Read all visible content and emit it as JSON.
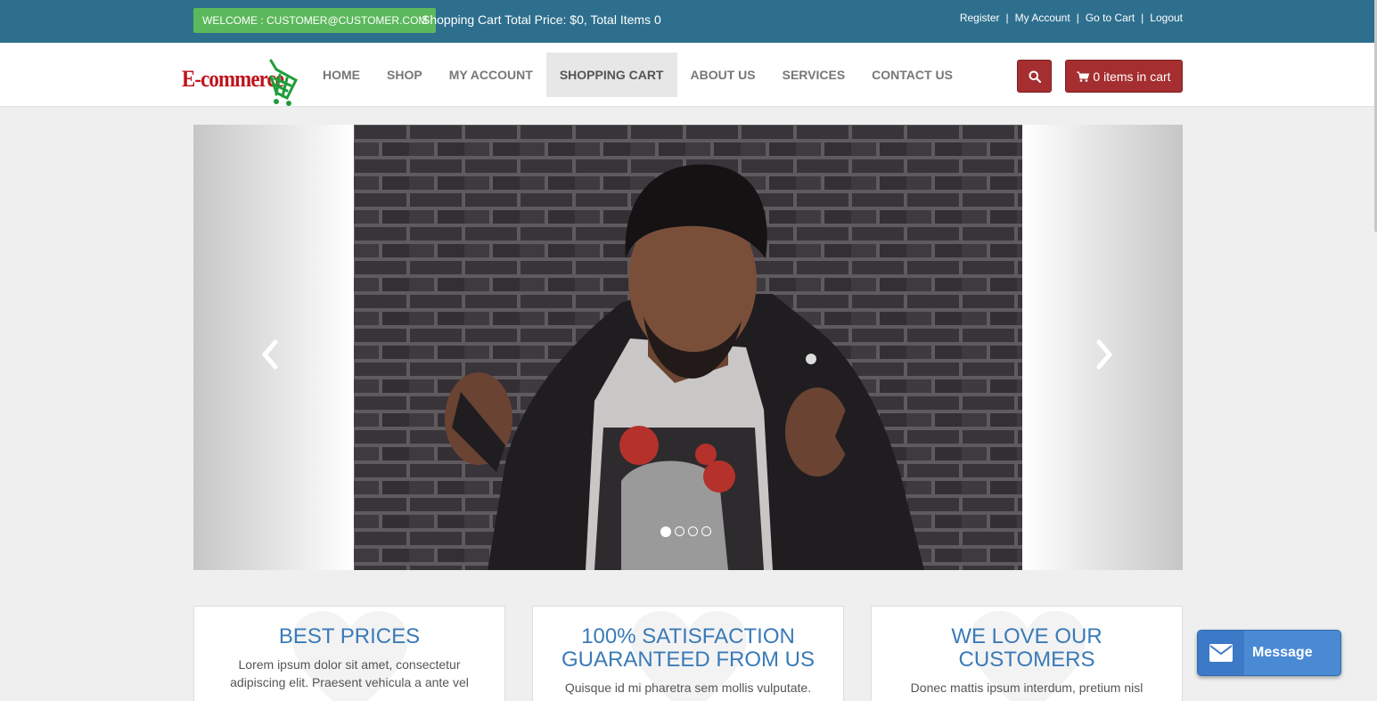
{
  "topbar": {
    "welcome": "WELCOME : CUSTOMER@CUSTOMER.COM",
    "cart_summary": "Shopping Cart Total Price: $0, Total Items 0",
    "links": [
      {
        "label": "Register"
      },
      {
        "label": "My Account"
      },
      {
        "label": "Go to Cart"
      },
      {
        "label": "Logout"
      }
    ],
    "separator": "|"
  },
  "logo": {
    "text": "E-commerce"
  },
  "nav": {
    "items": [
      {
        "label": "HOME"
      },
      {
        "label": "SHOP"
      },
      {
        "label": "MY ACCOUNT"
      },
      {
        "label": "SHOPPING CART"
      },
      {
        "label": "ABOUT US"
      },
      {
        "label": "SERVICES"
      },
      {
        "label": "CONTACT US"
      }
    ],
    "active_index": 3
  },
  "cart_button": {
    "label": "0 items in cart"
  },
  "carousel": {
    "slide_count": 4,
    "active_slide": 0
  },
  "features": [
    {
      "title": "BEST PRICES",
      "text": "Lorem ipsum dolor sit amet, consectetur adipiscing elit. Praesent vehicula a ante vel"
    },
    {
      "title": "100% SATISFACTION GUARANTEED FROM US",
      "text": "Quisque id mi pharetra sem mollis vulputate."
    },
    {
      "title": "WE LOVE OUR CUSTOMERS",
      "text": "Donec mattis ipsum interdum, pretium nisl eget, ullamcorper nisi. Praesent et mauris lectus."
    }
  ],
  "message_widget": {
    "label": "Message"
  },
  "colors": {
    "topbar": "#2e6f8e",
    "welcome_badge": "#5cb85c",
    "button_red": "#a52f30",
    "feature_title": "#3a7bb8",
    "message_blue": "#4a8ad4"
  },
  "icons": [
    "search-icon",
    "shopping-cart-icon",
    "chevron-left-icon",
    "chevron-right-icon",
    "heart-icon",
    "envelope-icon"
  ]
}
